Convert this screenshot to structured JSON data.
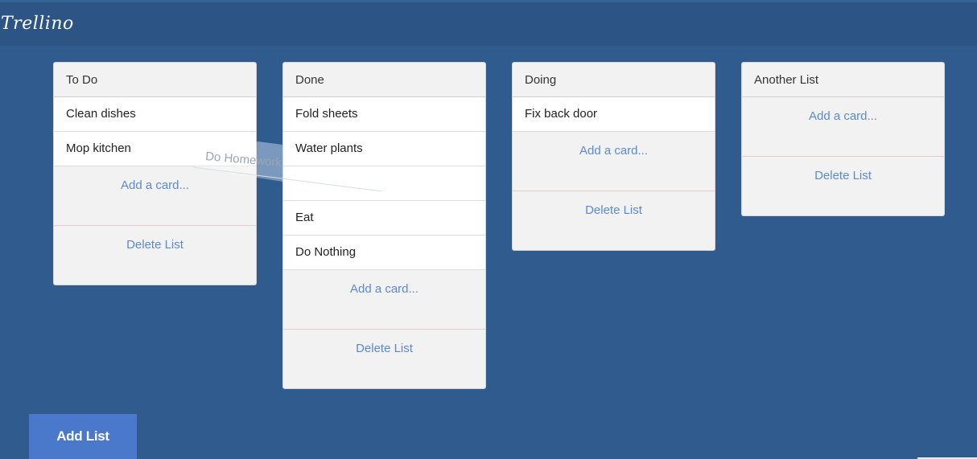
{
  "app": {
    "brand": "Trellino"
  },
  "lists": [
    {
      "title": "To Do",
      "cards": [
        "Clean dishes",
        "Mop kitchen"
      ],
      "add_card_label": "Add a card...",
      "delete_label": "Delete List"
    },
    {
      "title": "Done",
      "cards": [
        "Fold sheets",
        "Water plants",
        "",
        "Eat",
        "Do Nothing"
      ],
      "add_card_label": "Add a card...",
      "delete_label": "Delete List"
    },
    {
      "title": "Doing",
      "cards": [
        "Fix back door"
      ],
      "add_card_label": "Add a card...",
      "delete_label": "Delete List"
    },
    {
      "title": "Another List",
      "cards": [],
      "add_card_label": "Add a card...",
      "delete_label": "Delete List"
    }
  ],
  "drag": {
    "card_label": "Do Homework"
  },
  "footer": {
    "add_list_label": "Add List"
  },
  "colors": {
    "background": "#305b8e",
    "topbar": "#2c5585",
    "list_bg": "#f2f2f2",
    "link": "#5b8ad0",
    "add_list_button": "#4a78cb"
  }
}
